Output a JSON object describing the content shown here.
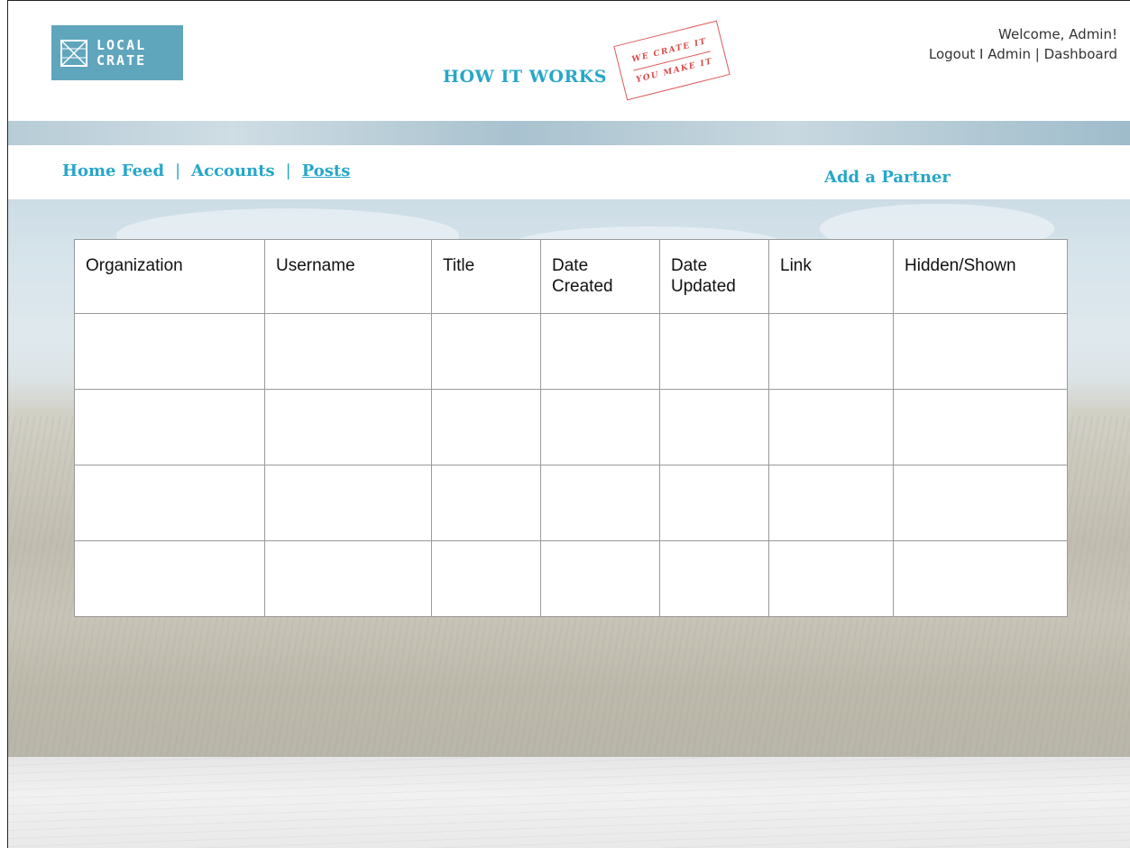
{
  "header": {
    "logo_lines": [
      "LOCAL",
      "CRATE"
    ],
    "how_it_works": "HOW IT WORKS",
    "stamp_lines": [
      "WE CRATE IT",
      "YOU MAKE IT"
    ],
    "welcome": "Welcome, Admin!",
    "links": {
      "logout": "Logout",
      "sep1": " I ",
      "admin": "Admin",
      "sep2": " | ",
      "dashboard": "Dashboard"
    }
  },
  "nav": {
    "items": [
      {
        "label": "Home Feed",
        "active": false
      },
      {
        "label": "Accounts",
        "active": false
      },
      {
        "label": "Posts",
        "active": true
      }
    ],
    "separator": "|",
    "add_partner": "Add a Partner"
  },
  "table": {
    "columns": [
      "Organization",
      "Username",
      "Title",
      "Date Created",
      "Date Updated",
      "Link",
      "Hidden/Shown"
    ],
    "rows": [
      [
        "",
        "",
        "",
        "",
        "",
        "",
        ""
      ],
      [
        "",
        "",
        "",
        "",
        "",
        "",
        ""
      ],
      [
        "",
        "",
        "",
        "",
        "",
        "",
        ""
      ],
      [
        "",
        "",
        "",
        "",
        "",
        "",
        ""
      ]
    ]
  },
  "colors": {
    "accent": "#27a7c8",
    "logo_bg": "#5fa6bd",
    "stamp_red": "#d94b4b"
  }
}
